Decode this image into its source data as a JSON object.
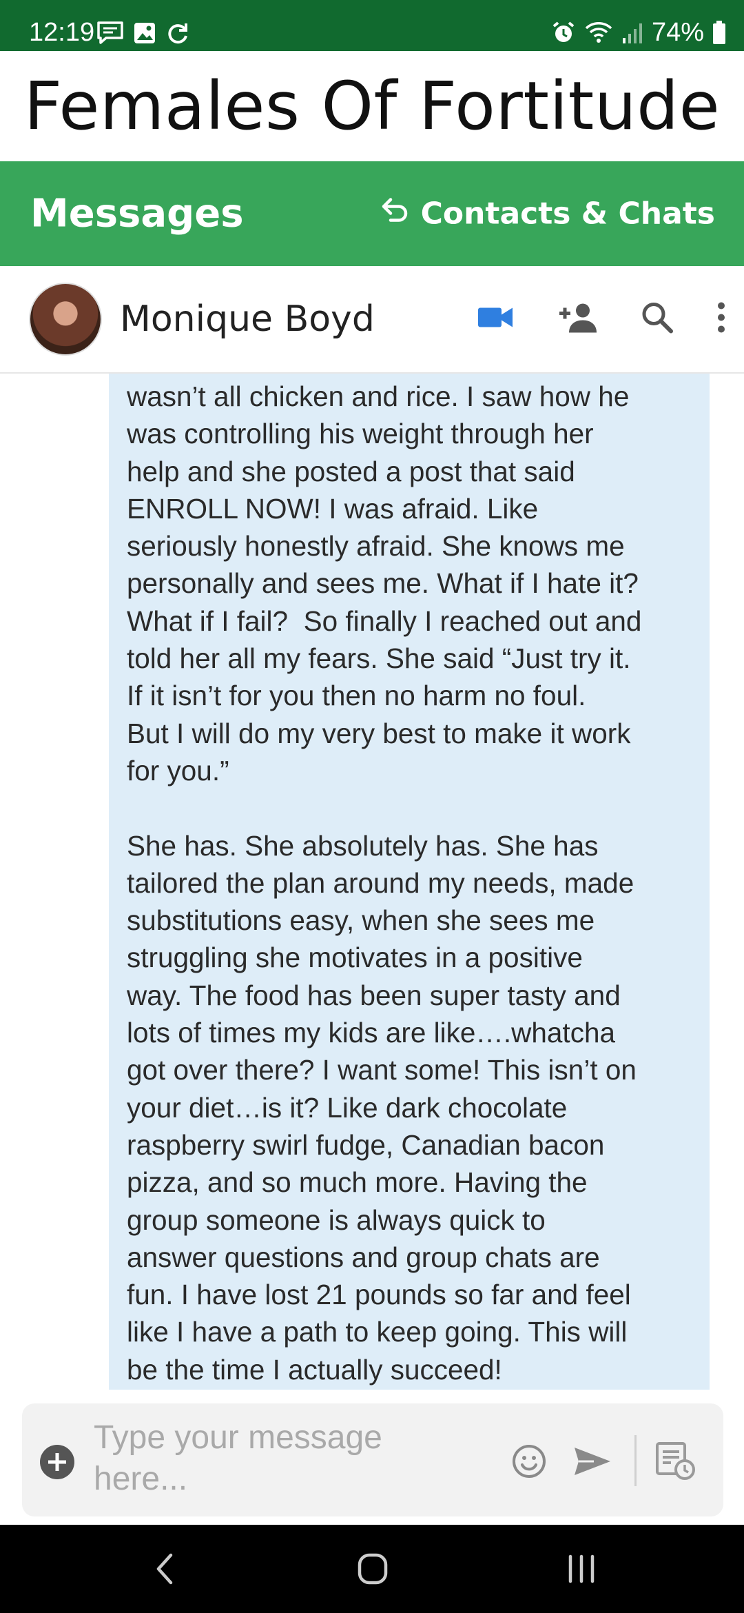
{
  "status_bar": {
    "time": "12:19",
    "battery": "74%",
    "icons": [
      "chat-notification-icon",
      "image-notification-icon",
      "sync-icon",
      "alarm-icon",
      "wifi-icon",
      "signal-icon",
      "battery-icon"
    ]
  },
  "brand": {
    "title": "Females Of Fortitude"
  },
  "nav": {
    "title": "Messages",
    "contacts_label": "Contacts & Chats"
  },
  "chat_header": {
    "contact_name": "Monique Boyd",
    "video_color": "#2f7fe0"
  },
  "message": {
    "text": "wasn’t all chicken and rice. I saw how he\nwas controlling his weight through her\nhelp and she posted a post that said\nENROLL NOW! I was afraid. Like\nseriously honestly afraid. She knows me\npersonally and sees me. What if I hate it?\nWhat if I fail?  So finally I reached out and\ntold her all my fears. She said “Just try it.\nIf it isn’t for you then no harm no foul.\nBut I will do my very best to make it work\nfor you.”\n\nShe has. She absolutely has. She has\ntailored the plan around my needs, made\nsubstitutions easy, when she sees me\nstruggling she motivates in a positive\nway. The food has been super tasty and\nlots of times my kids are like….whatcha\ngot over there? I want some! This isn’t on\nyour diet…is it? Like dark chocolate\nraspberry swirl fudge, Canadian bacon\npizza, and so much more. Having the\ngroup someone is always quick to\nanswer questions and group chats are\nfun. I have lost 21 pounds so far and feel\nlike I have a path to keep going. This will\nbe the time I actually succeed!"
  },
  "composer": {
    "placeholder": "Type your message here..."
  },
  "colors": {
    "status_bar": "#116a2f",
    "nav_bar": "#38a65a",
    "bubble": "#deedf8"
  }
}
